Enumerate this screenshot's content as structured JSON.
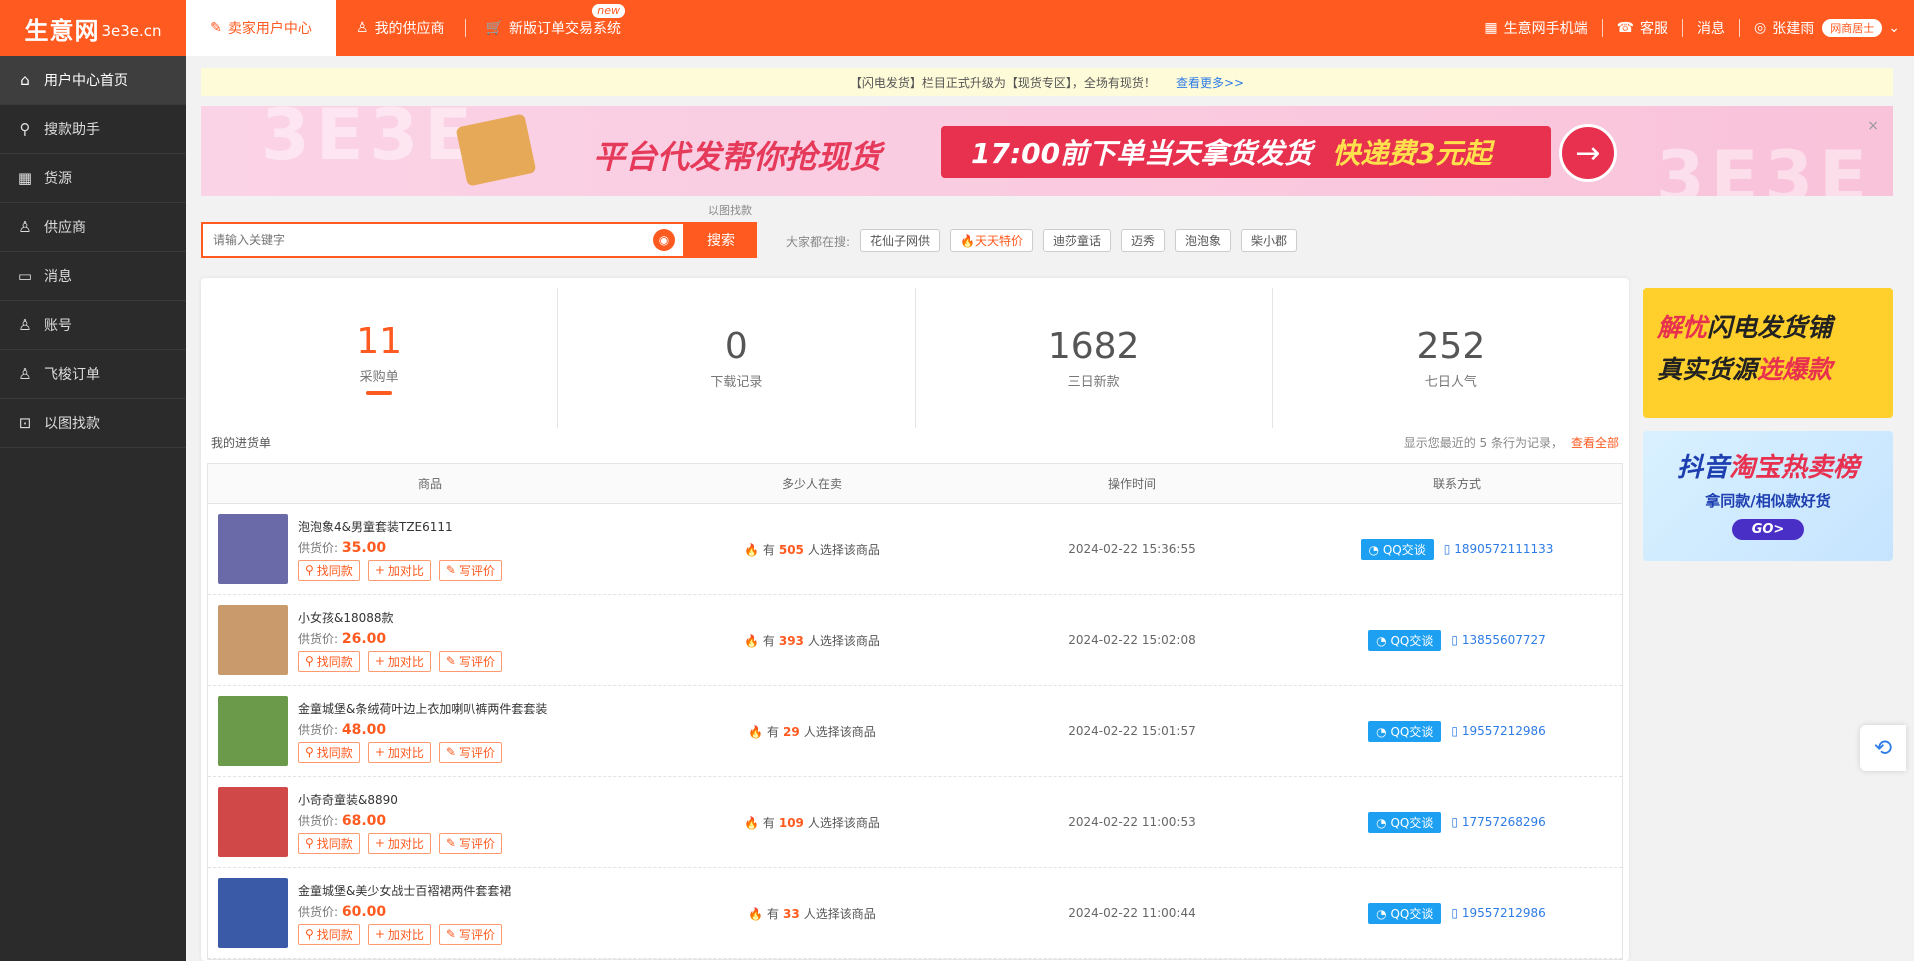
{
  "header": {
    "logo_cn": "生意网",
    "logo_en": "3e3e.cn",
    "tabs": [
      {
        "label": "卖家用户中心",
        "icon": "edit-icon",
        "active": true
      },
      {
        "label": "我的供应商",
        "icon": "user-icon"
      },
      {
        "label": "新版订单交易系统",
        "icon": "cart-icon",
        "badge": "new"
      }
    ],
    "right": {
      "mobile": "生意网手机端",
      "service": "客服",
      "message": "消息",
      "username": "张建雨",
      "vip": "网商居士"
    }
  },
  "sidebar": {
    "items": [
      {
        "label": "用户中心首页",
        "icon": "home-icon",
        "active": true
      },
      {
        "label": "搜款助手",
        "icon": "search-icon"
      },
      {
        "label": "货源",
        "icon": "grid-icon"
      },
      {
        "label": "供应商",
        "icon": "user-icon"
      },
      {
        "label": "消息",
        "icon": "message-icon"
      },
      {
        "label": "账号",
        "icon": "account-icon"
      },
      {
        "label": "飞梭订单",
        "icon": "order-icon"
      },
      {
        "label": "以图找款",
        "icon": "image-search-icon"
      }
    ]
  },
  "notice": {
    "text": "【闪电发货】栏目正式升级为【现货专区】，全场有现货！",
    "link": "查看更多>>"
  },
  "banner": {
    "ghost": "3E3E",
    "title": "平台代发帮你抢现货",
    "highlight": "17:00前下单当天拿货发货",
    "fee": "快递费3元起",
    "close": "×"
  },
  "search": {
    "hint": "以图找款",
    "placeholder": "请输入关键字",
    "button": "搜索",
    "hot_label": "大家都在搜:",
    "hot_tags": [
      {
        "label": "花仙子网供",
        "hot": false
      },
      {
        "label": "天天特价",
        "hot": true
      },
      {
        "label": "迪莎童话",
        "hot": false
      },
      {
        "label": "迈秀",
        "hot": false
      },
      {
        "label": "泡泡象",
        "hot": false
      },
      {
        "label": "柴小郡",
        "hot": false
      }
    ]
  },
  "stats": [
    {
      "value": "11",
      "label": "采购单",
      "active": true
    },
    {
      "value": "0",
      "label": "下载记录"
    },
    {
      "value": "1682",
      "label": "三日新款"
    },
    {
      "value": "252",
      "label": "七日人气"
    }
  ],
  "list": {
    "title": "我的进货单",
    "note": "显示您最近的 5 条行为记录，",
    "view_all": "查看全部",
    "columns": [
      "商品",
      "多少人在卖",
      "操作时间",
      "联系方式"
    ],
    "price_label": "供货价:",
    "sellers_prefix": "有",
    "sellers_suffix": "人选择该商品",
    "actions": [
      "找同款",
      "加对比",
      "写评价"
    ],
    "qq_label": "QQ交谈",
    "rows": [
      {
        "name": "泡泡象4&男童套装TZE6111",
        "price": "35.00",
        "sellers": "505",
        "time": "2024-02-22 15:36:55",
        "phone": "1890572111133",
        "thumb": "#6a6aa8"
      },
      {
        "name": "小女孩&18088款",
        "price": "26.00",
        "sellers": "393",
        "time": "2024-02-22 15:02:08",
        "phone": "13855607727",
        "thumb": "#c99a6b"
      },
      {
        "name": "金童城堡&条绒荷叶边上衣加喇叭裤两件套套装",
        "price": "48.00",
        "sellers": "29",
        "time": "2024-02-22 15:01:57",
        "phone": "19557212986",
        "thumb": "#6b9a4a"
      },
      {
        "name": "小奇奇童装&8890",
        "price": "68.00",
        "sellers": "109",
        "time": "2024-02-22 11:00:53",
        "phone": "17757268296",
        "thumb": "#d04848"
      },
      {
        "name": "金童城堡&美少女战士百褶裙两件套套裙",
        "price": "60.00",
        "sellers": "33",
        "time": "2024-02-22 11:00:44",
        "phone": "19557212986",
        "thumb": "#3a5aa8"
      }
    ]
  },
  "ads": {
    "ad1_l1a": "解忧",
    "ad1_l1b": "闪电发货铺",
    "ad1_l2a": "真实货源",
    "ad1_l2b": "选爆款",
    "ad2_l1a": "抖音",
    "ad2_l1b": "淘宝热卖榜",
    "ad2_l2": "拿同款/相似款好货",
    "ad2_go": "GO>"
  },
  "colors": {
    "brand": "#ff5a1f",
    "link": "#2d7be5",
    "qq": "#1ea0f2"
  }
}
